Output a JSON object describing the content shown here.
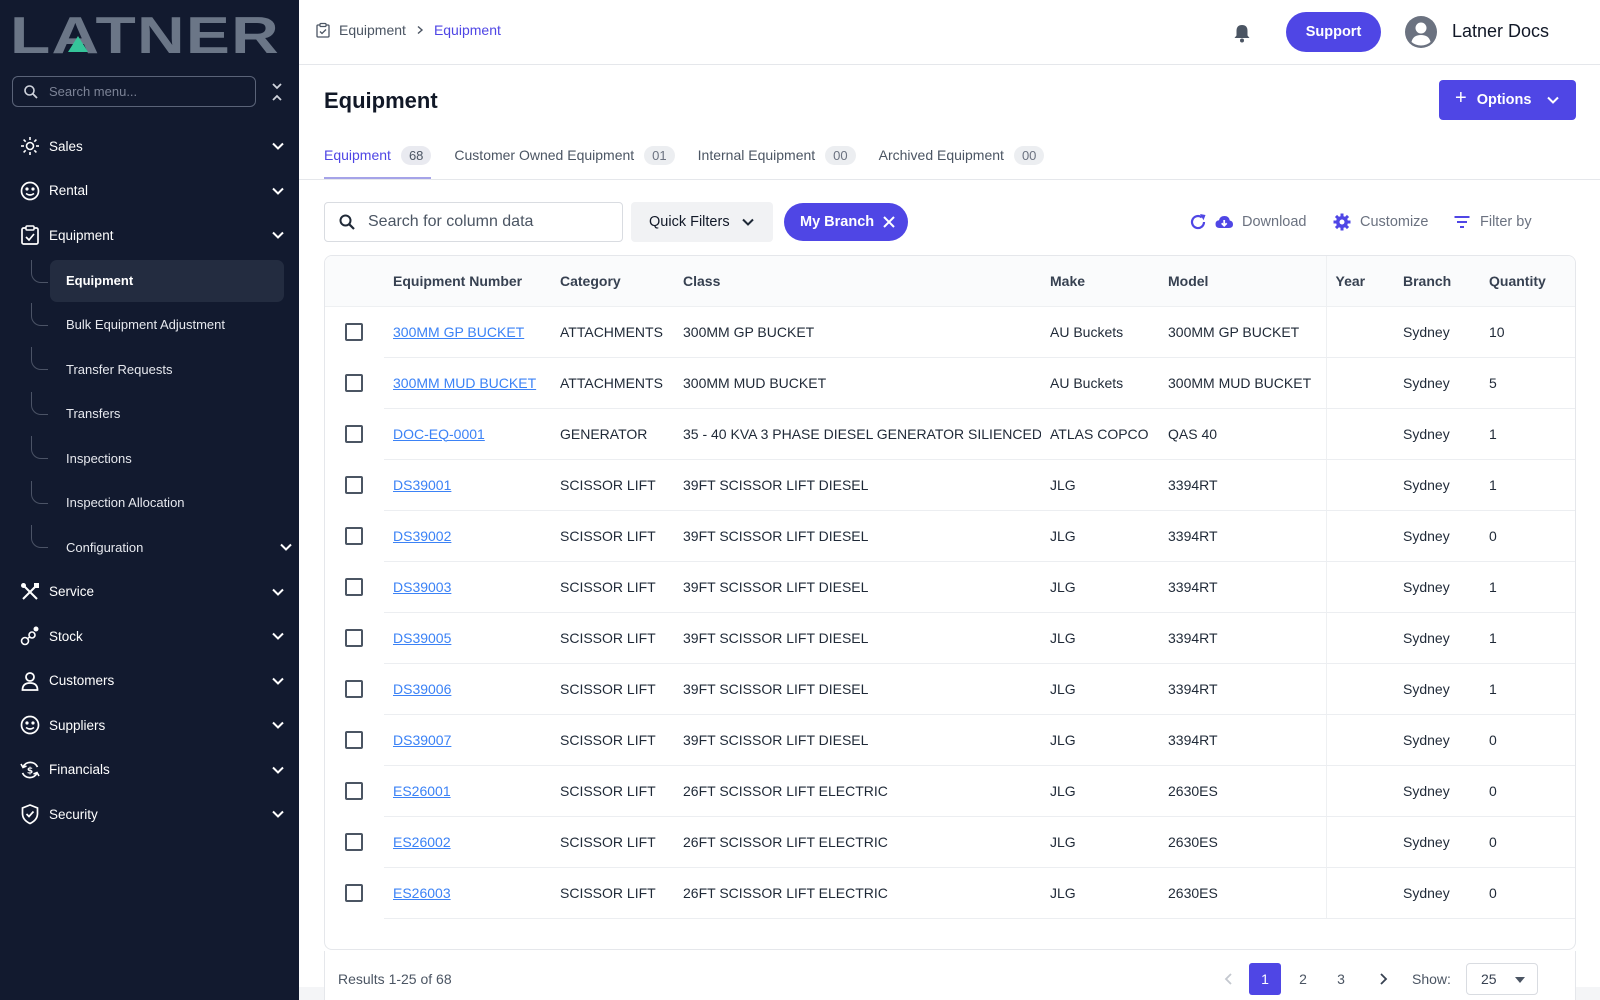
{
  "app": {
    "logo_text": "LATNER",
    "user_name": "Latner Docs",
    "support_label": "Support"
  },
  "colors": {
    "sidebar_bg": "#121a2f",
    "accent": "#4f46e5",
    "logo_gray": "#6b7687",
    "logo_green": "#35c49a",
    "link": "#3b82f6"
  },
  "sidebar": {
    "search_placeholder": "Search menu...",
    "items": [
      {
        "label": "Sales",
        "icon": "sales-icon"
      },
      {
        "label": "Rental",
        "icon": "rental-icon"
      },
      {
        "label": "Equipment",
        "icon": "equipment-icon"
      },
      {
        "label": "Service",
        "icon": "service-icon"
      },
      {
        "label": "Stock",
        "icon": "stock-icon"
      },
      {
        "label": "Customers",
        "icon": "customers-icon"
      },
      {
        "label": "Suppliers",
        "icon": "suppliers-icon"
      },
      {
        "label": "Financials",
        "icon": "financials-icon"
      },
      {
        "label": "Security",
        "icon": "security-icon"
      }
    ],
    "equipment_sub": [
      "Equipment",
      "Bulk Equipment Adjustment",
      "Transfer Requests",
      "Transfers",
      "Inspections",
      "Inspection Allocation",
      "Configuration"
    ]
  },
  "breadcrumb": [
    "Equipment",
    "Equipment"
  ],
  "page": {
    "title": "Equipment",
    "options_label": "Options"
  },
  "tabs": [
    {
      "label": "Equipment",
      "count": "68"
    },
    {
      "label": "Customer Owned Equipment",
      "count": "01"
    },
    {
      "label": "Internal Equipment",
      "count": "00"
    },
    {
      "label": "Archived Equipment",
      "count": "00"
    }
  ],
  "toolbar": {
    "search_placeholder": "Search for column data",
    "quick_filters": "Quick Filters",
    "branch_chip": "My Branch",
    "download": "Download",
    "customize": "Customize",
    "filter_by": "Filter by"
  },
  "table": {
    "columns": [
      "Equipment Number",
      "Category",
      "Class",
      "Make",
      "Model",
      "Year",
      "Branch",
      "Quantity"
    ],
    "rows": [
      [
        "300MM GP BUCKET",
        "ATTACHMENTS",
        "300MM GP BUCKET",
        "AU Buckets",
        "300MM GP BUCKET",
        "",
        "Sydney",
        "10"
      ],
      [
        "300MM MUD BUCKET",
        "ATTACHMENTS",
        "300MM MUD BUCKET",
        "AU Buckets",
        "300MM MUD BUCKET",
        "",
        "Sydney",
        "5"
      ],
      [
        "DOC-EQ-0001",
        "GENERATOR",
        "35 - 40 KVA 3 PHASE DIESEL GENERATOR SILIENCED",
        "ATLAS COPCO",
        "QAS 40",
        "",
        "Sydney",
        "1"
      ],
      [
        "DS39001",
        "SCISSOR LIFT",
        "39FT SCISSOR LIFT DIESEL",
        "JLG",
        "3394RT",
        "",
        "Sydney",
        "1"
      ],
      [
        "DS39002",
        "SCISSOR LIFT",
        "39FT SCISSOR LIFT DIESEL",
        "JLG",
        "3394RT",
        "",
        "Sydney",
        "0"
      ],
      [
        "DS39003",
        "SCISSOR LIFT",
        "39FT SCISSOR LIFT DIESEL",
        "JLG",
        "3394RT",
        "",
        "Sydney",
        "1"
      ],
      [
        "DS39005",
        "SCISSOR LIFT",
        "39FT SCISSOR LIFT DIESEL",
        "JLG",
        "3394RT",
        "",
        "Sydney",
        "1"
      ],
      [
        "DS39006",
        "SCISSOR LIFT",
        "39FT SCISSOR LIFT DIESEL",
        "JLG",
        "3394RT",
        "",
        "Sydney",
        "1"
      ],
      [
        "DS39007",
        "SCISSOR LIFT",
        "39FT SCISSOR LIFT DIESEL",
        "JLG",
        "3394RT",
        "",
        "Sydney",
        "0"
      ],
      [
        "ES26001",
        "SCISSOR LIFT",
        "26FT SCISSOR LIFT ELECTRIC",
        "JLG",
        "2630ES",
        "",
        "Sydney",
        "0"
      ],
      [
        "ES26002",
        "SCISSOR LIFT",
        "26FT SCISSOR LIFT ELECTRIC",
        "JLG",
        "2630ES",
        "",
        "Sydney",
        "0"
      ],
      [
        "ES26003",
        "SCISSOR LIFT",
        "26FT SCISSOR LIFT ELECTRIC",
        "JLG",
        "2630ES",
        "",
        "Sydney",
        "0"
      ]
    ]
  },
  "footer": {
    "results": "Results 1-25 of 68",
    "pages": [
      "1",
      "2",
      "3"
    ],
    "current_page": "1",
    "show_label": "Show:",
    "page_size": "25"
  }
}
